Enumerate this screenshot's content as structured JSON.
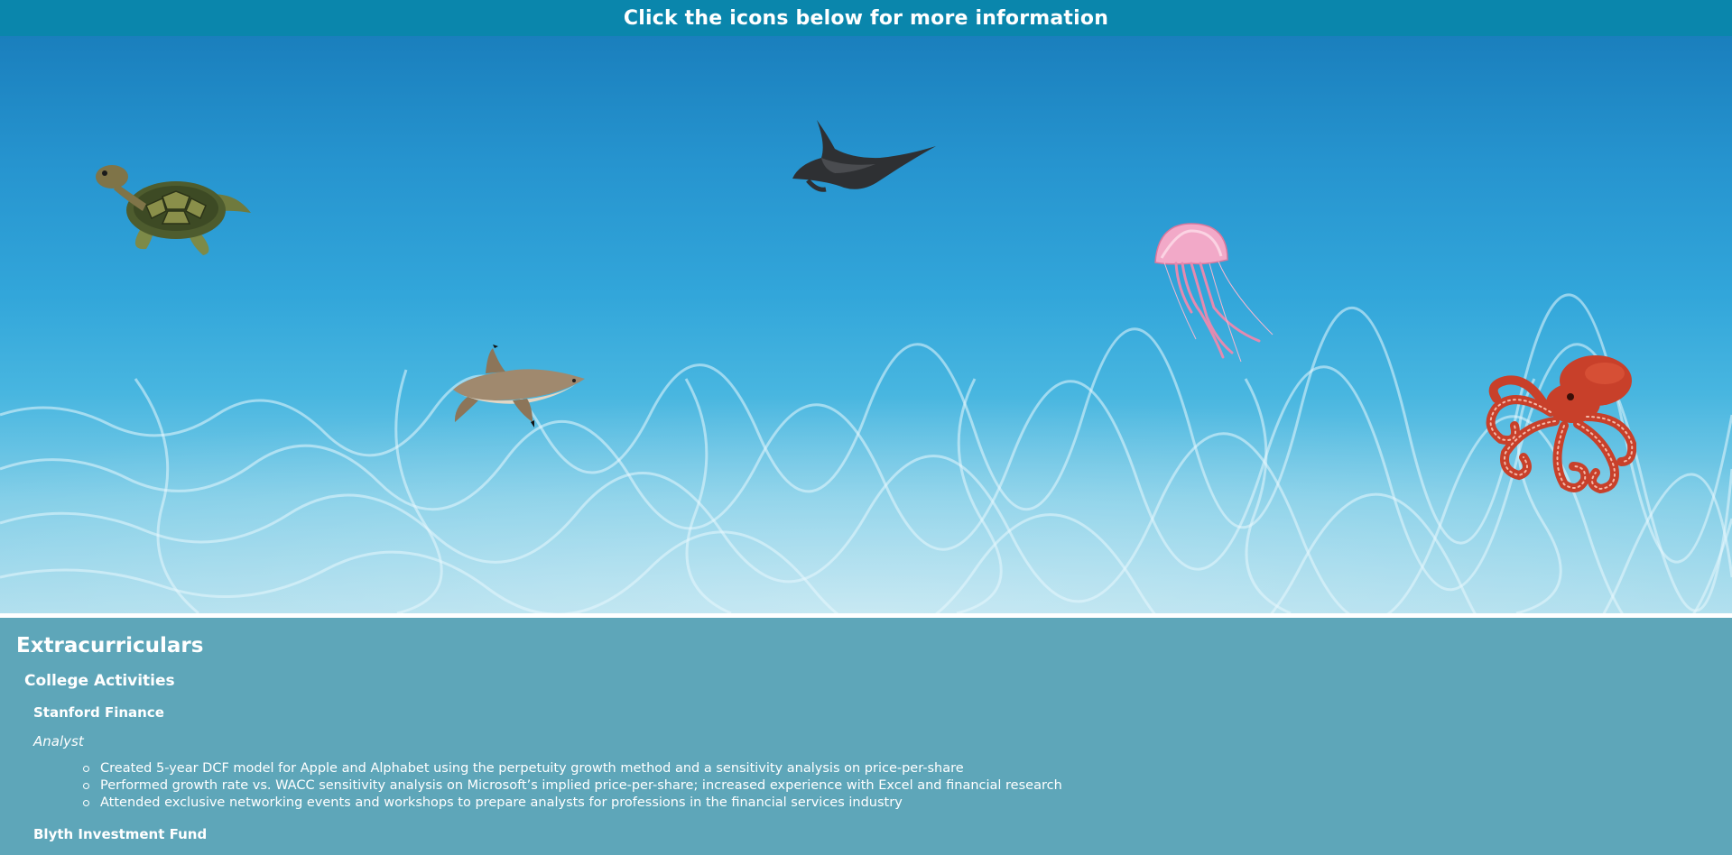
{
  "header": {
    "title": "Click the icons below for more information"
  },
  "ocean": {
    "creatures": [
      {
        "name": "sea-turtle-icon"
      },
      {
        "name": "manta-ray-icon"
      },
      {
        "name": "jellyfish-icon"
      },
      {
        "name": "shark-icon"
      },
      {
        "name": "octopus-icon"
      }
    ]
  },
  "section": {
    "title": "Extracurriculars",
    "subtitle": "College Activities",
    "org": "Stanford Finance",
    "role": "Analyst",
    "bullets": [
      "Created 5-year DCF model for Apple and Alphabet using the perpetuity growth method and a sensitivity analysis on price-per-share",
      "Performed growth rate vs. WACC sensitivity analysis on Microsoft’s implied price-per-share; increased experience with Excel and financial research",
      "Attended exclusive networking events and workshops to prepare analysts for professions in the financial services industry"
    ],
    "next_org": "Blyth Investment Fund"
  },
  "colors": {
    "header": "#0a86ac",
    "content": "#5ea6b9",
    "ocean": "#2694cf"
  }
}
